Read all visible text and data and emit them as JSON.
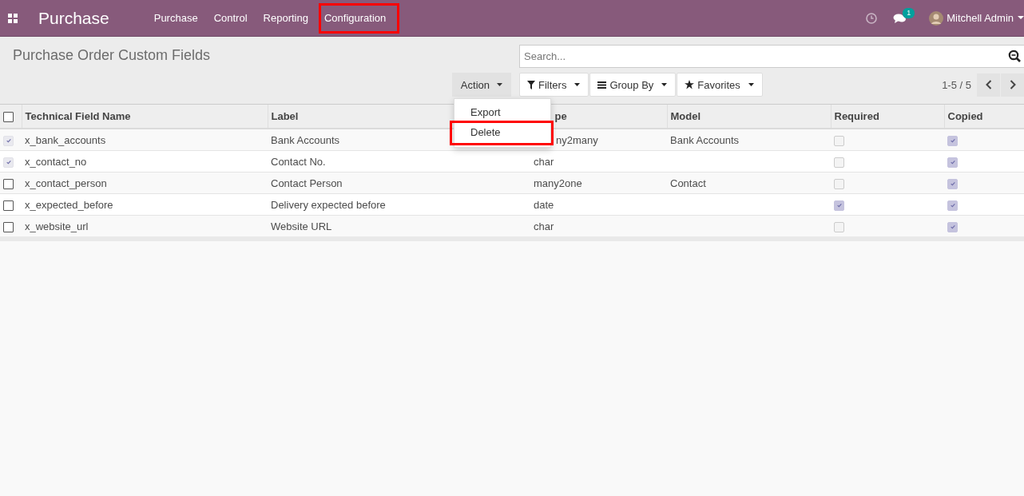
{
  "navbar": {
    "app_name": "Purchase",
    "menus": [
      {
        "label": "Purchase",
        "highlighted": false
      },
      {
        "label": "Control",
        "highlighted": false
      },
      {
        "label": "Reporting",
        "highlighted": false
      },
      {
        "label": "Configuration",
        "highlighted": true
      }
    ],
    "messages_badge": "1",
    "user": "Mitchell Admin"
  },
  "control_panel": {
    "title": "Purchase Order Custom Fields",
    "search": {
      "placeholder": "Search..."
    },
    "action_button": "Action",
    "action_menu": [
      {
        "label": "Export",
        "highlighted": false
      },
      {
        "label": "Delete",
        "highlighted": true
      }
    ],
    "filters": [
      {
        "kind": "filter",
        "label": "Filters"
      },
      {
        "kind": "group",
        "label": "Group By"
      },
      {
        "kind": "favorite",
        "label": "Favorites"
      }
    ],
    "pager": "1-5 / 5"
  },
  "table": {
    "all_selected": false,
    "columns": [
      {
        "label": "Technical Field Name",
        "partly_hidden": false
      },
      {
        "label": "Label",
        "partly_hidden": false
      },
      {
        "label": "pe",
        "partly_hidden": true
      },
      {
        "label": "Model",
        "partly_hidden": false
      },
      {
        "label": "Required",
        "partly_hidden": false
      },
      {
        "label": "Copied",
        "partly_hidden": false
      }
    ],
    "rows": [
      {
        "selected": true,
        "name": "x_bank_accounts",
        "label": "Bank Accounts",
        "type": "ny2many",
        "type_partly_hidden": true,
        "model": "Bank Accounts",
        "required": false,
        "copied": true
      },
      {
        "selected": true,
        "name": "x_contact_no",
        "label": "Contact No.",
        "type": "char",
        "type_partly_hidden": false,
        "model": "",
        "required": false,
        "copied": true
      },
      {
        "selected": false,
        "name": "x_contact_person",
        "label": "Contact Person",
        "type": "many2one",
        "type_partly_hidden": false,
        "model": "Contact",
        "required": false,
        "copied": true
      },
      {
        "selected": false,
        "name": "x_expected_before",
        "label": "Delivery expected before",
        "type": "date",
        "type_partly_hidden": false,
        "model": "",
        "required": true,
        "copied": true
      },
      {
        "selected": false,
        "name": "x_website_url",
        "label": "Website URL",
        "type": "char",
        "type_partly_hidden": false,
        "model": "",
        "required": false,
        "copied": true
      }
    ]
  }
}
